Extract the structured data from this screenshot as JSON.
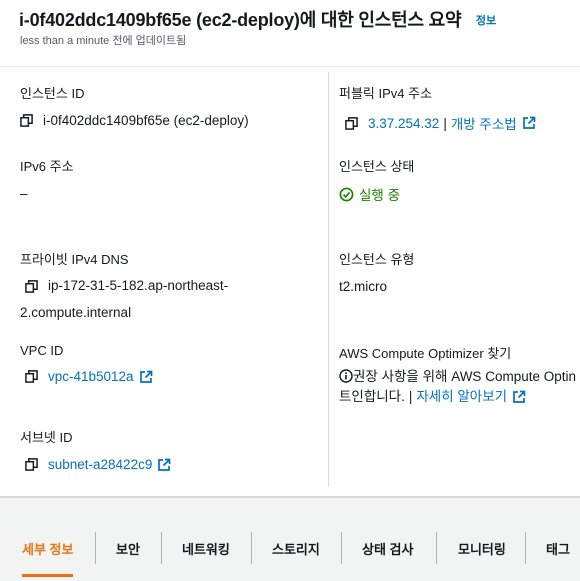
{
  "header": {
    "title": "i-0f402ddc1409bf65e (ec2-deploy)에 대한 인스턴스 요약",
    "info_link": "정보",
    "updated": "less than a minute 전에 업데이트됨"
  },
  "fields": {
    "instance_id": {
      "label": "인스턴스 ID",
      "value": "i-0f402ddc1409bf65e (ec2-deploy)"
    },
    "public_ipv4": {
      "label": "퍼블릭 IPv4 주소",
      "value": "3.37.254.32",
      "separator": "|",
      "link": "개방 주소법"
    },
    "ipv6": {
      "label": "IPv6 주소",
      "value": "–"
    },
    "instance_state": {
      "label": "인스턴스 상태",
      "value": "실행 중",
      "status_color": "#1d8102"
    },
    "private_dns": {
      "label": "프라이빗 IPv4 DNS",
      "value_line1": "ip-172-31-5-182.ap-northeast-",
      "value_line2": "2.compute.internal"
    },
    "instance_type": {
      "label": "인스턴스 유형",
      "value": "t2.micro"
    },
    "vpc_id": {
      "label": "VPC ID",
      "value": "vpc-41b5012a"
    },
    "optimizer": {
      "label": "AWS Compute Optimizer 찾기",
      "text_line1": "권장 사항을 위해 AWS Compute Optin",
      "text_line2": "트인합니다.",
      "separator": "|",
      "link": "자세히 알아보기"
    },
    "subnet_id": {
      "label": "서브넷 ID",
      "value": "subnet-a28422c9"
    }
  },
  "tabs": [
    {
      "label": "세부 정보",
      "active": true
    },
    {
      "label": "보안"
    },
    {
      "label": "네트워킹"
    },
    {
      "label": "스토리지"
    },
    {
      "label": "상태 검사"
    },
    {
      "label": "모니터링"
    },
    {
      "label": "태그"
    }
  ],
  "colors": {
    "link": "#0073bb",
    "accent": "#ec7211",
    "success": "#1d8102"
  },
  "icons": [
    "copy-icon",
    "external-link-icon",
    "check-circle-icon",
    "info-circle-icon"
  ]
}
